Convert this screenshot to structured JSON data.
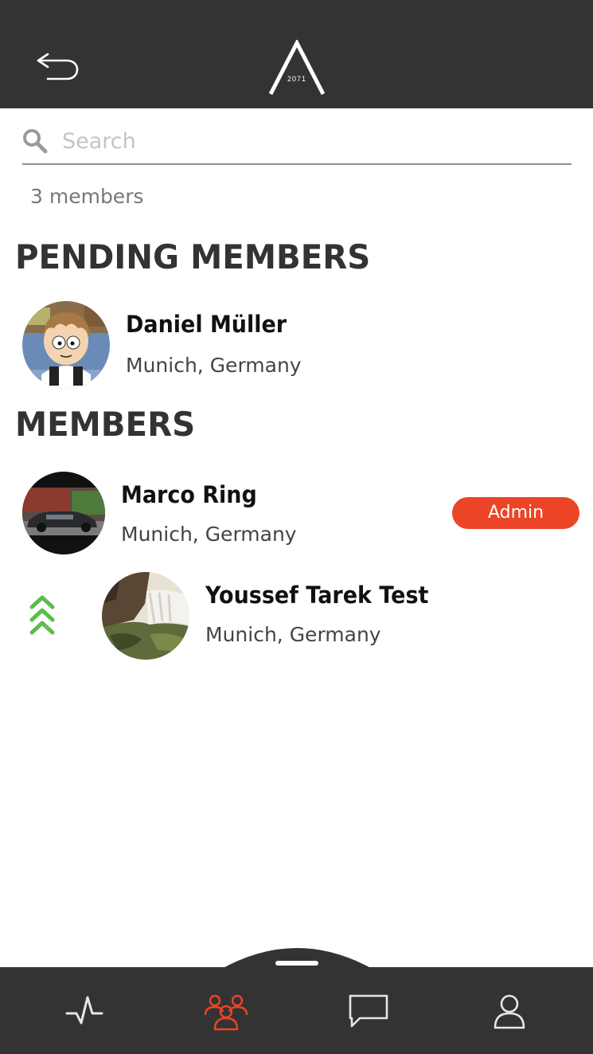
{
  "header": {
    "back_icon": "back-arrow-icon",
    "logo_icon": "app-logo",
    "logo_year": "2071"
  },
  "search": {
    "placeholder": "Search",
    "value": "",
    "icon": "search-icon"
  },
  "member_count": "3 members",
  "sections": {
    "pending_title": "PENDING MEMBERS",
    "members_title": "MEMBERS"
  },
  "pending_members": [
    {
      "name": "Daniel Müller",
      "location": "Munich, Germany"
    }
  ],
  "members": [
    {
      "name": "Marco Ring",
      "location": "Munich, Germany",
      "badge": "Admin"
    },
    {
      "name": "Youssef Tarek Test",
      "location": "Munich, Germany",
      "action_icon": "promote-chevrons-icon"
    }
  ],
  "tabs": [
    {
      "icon": "activity-pulse-icon",
      "active": false
    },
    {
      "icon": "members-group-icon",
      "active": true
    },
    {
      "icon": "chat-bubble-icon",
      "active": false
    },
    {
      "icon": "profile-user-icon",
      "active": false
    }
  ],
  "colors": {
    "header_bg": "#333333",
    "accent": "#ec4427",
    "promote_green": "#5bbe4a",
    "tab_inactive": "#e0e0e0"
  }
}
